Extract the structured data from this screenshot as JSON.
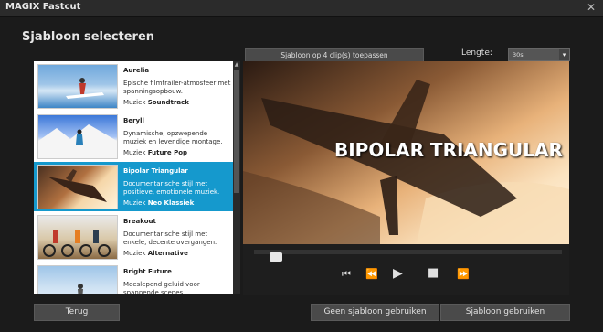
{
  "window": {
    "title": "MAGIX Fastcut",
    "close": "✕"
  },
  "heading": "Sjabloon selecteren",
  "apply_button": "Sjabloon op 4 clip(s) toepassen",
  "length": {
    "label": "Lengte:",
    "value": "30s"
  },
  "templates": [
    {
      "name": "Aurelia",
      "desc": "Epische filmtrailer-atmosfeer met spanningsopbouw.",
      "music_label": "Muziek",
      "music": "Soundtrack"
    },
    {
      "name": "Beryll",
      "desc": "Dynamische, opzwepende muziek en levendige montage.",
      "music_label": "Muziek",
      "music": "Future Pop"
    },
    {
      "name": "Bipolar Triangular",
      "desc": "Documentarische stijl met positieve, emotionele muziek.",
      "music_label": "Muziek",
      "music": "Neo Klassiek"
    },
    {
      "name": "Breakout",
      "desc": "Documentarische stijl met enkele, decente overgangen.",
      "music_label": "Muziek",
      "music": "Alternative"
    },
    {
      "name": "Bright Future",
      "desc": "Meeslepend geluid voor spannende scenes.",
      "music_label": "",
      "music": ""
    }
  ],
  "preview": {
    "overlay_title": "BIPOLAR TRIANGULAR",
    "progress": 0.05
  },
  "buttons": {
    "back": "Terug",
    "no_template": "Geen sjabloon gebruiken",
    "use_template": "Sjabloon gebruiken"
  }
}
